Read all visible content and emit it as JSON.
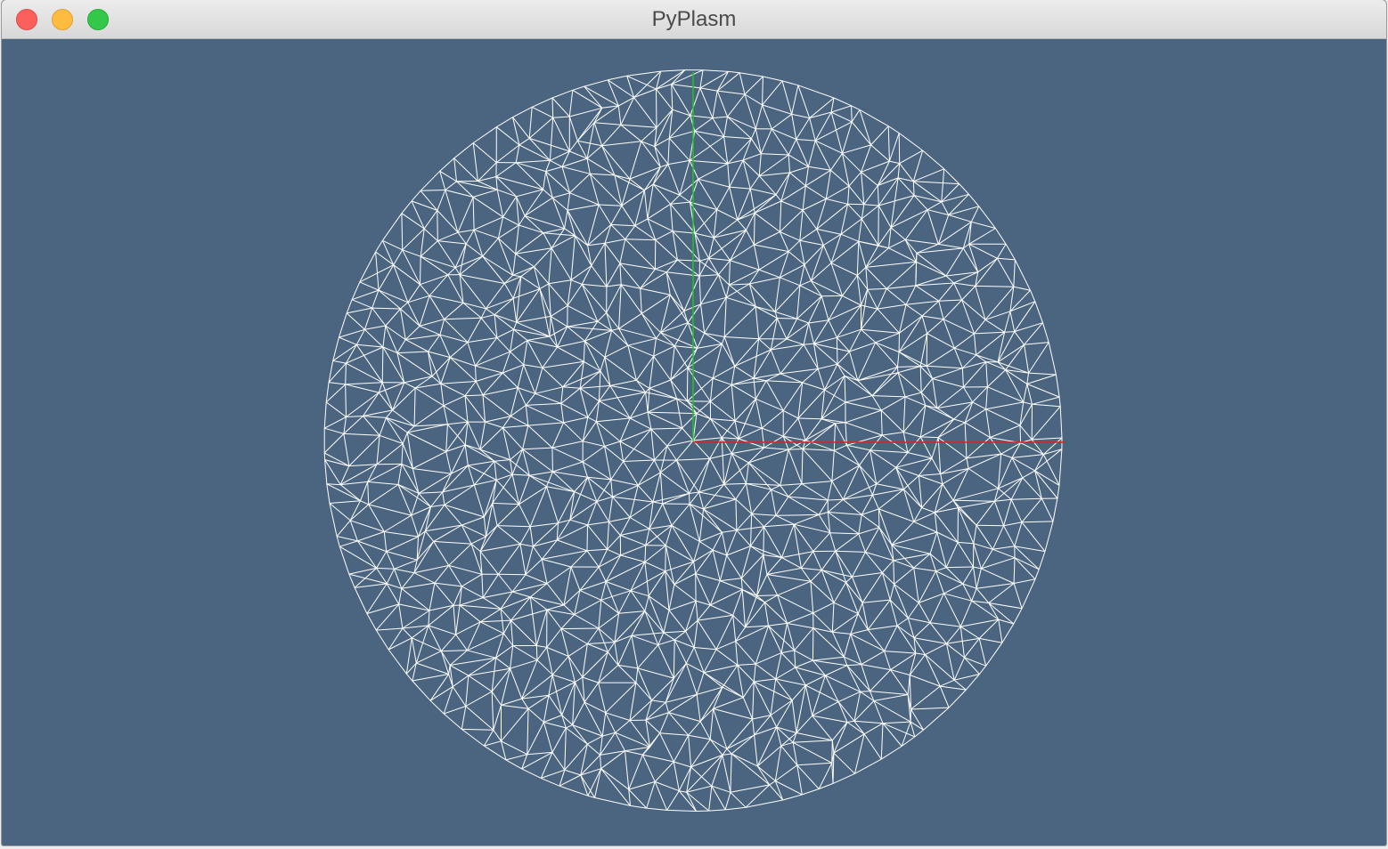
{
  "window": {
    "title": "PyPlasm",
    "buttons": [
      {
        "name": "close",
        "color": "#fc605c"
      },
      {
        "name": "minimize",
        "color": "#fdbc40"
      },
      {
        "name": "zoom",
        "color": "#34c84a"
      }
    ]
  },
  "viewport": {
    "background": "#4b6580",
    "mesh": {
      "shape": "disc",
      "style": "wireframe",
      "edge_color": "#ffffff"
    },
    "axes": [
      {
        "name": "x",
        "color": "#e02020"
      },
      {
        "name": "y",
        "color": "#1ec81e"
      }
    ]
  }
}
